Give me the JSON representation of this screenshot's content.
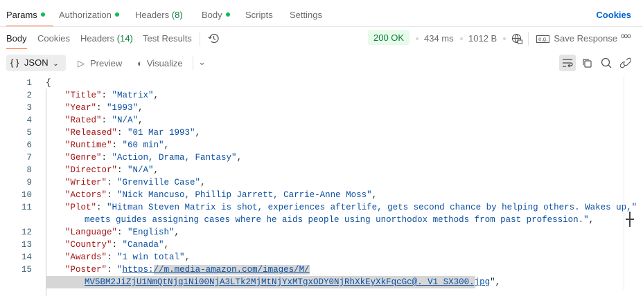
{
  "request_tabs": [
    {
      "label": "Params",
      "dot": true
    },
    {
      "label": "Authorization",
      "dot": true
    },
    {
      "label": "Headers",
      "count": "(8)"
    },
    {
      "label": "Body",
      "dot": true
    },
    {
      "label": "Scripts"
    },
    {
      "label": "Settings"
    }
  ],
  "cookies_link": "Cookies",
  "response_tabs": [
    {
      "label": "Body"
    },
    {
      "label": "Cookies"
    },
    {
      "label": "Headers",
      "count": "(14)"
    },
    {
      "label": "Test Results"
    }
  ],
  "status": "200 OK",
  "time": "434 ms",
  "size": "1012 B",
  "save_response": "Save Response",
  "toolbar": {
    "format": "JSON",
    "preview": "Preview",
    "visualize": "Visualize"
  },
  "lines": [
    {
      "n": "1",
      "open": "{"
    },
    {
      "n": "2",
      "key": "Title",
      "value": "Matrix"
    },
    {
      "n": "3",
      "key": "Year",
      "value": "1993"
    },
    {
      "n": "4",
      "key": "Rated",
      "value": "N/A"
    },
    {
      "n": "5",
      "key": "Released",
      "value": "01 Mar 1993"
    },
    {
      "n": "6",
      "key": "Runtime",
      "value": "60 min"
    },
    {
      "n": "7",
      "key": "Genre",
      "value": "Action, Drama, Fantasy"
    },
    {
      "n": "8",
      "key": "Director",
      "value": "N/A"
    },
    {
      "n": "9",
      "key": "Writer",
      "value": "Grenville Case"
    },
    {
      "n": "10",
      "key": "Actors",
      "value": "Nick Mancuso, Phillip Jarrett, Carrie-Anne Moss"
    },
    {
      "n": "11",
      "key": "Plot",
      "value": "Hitman Steven Matrix is shot, experiences afterlife, gets second chance by helping others. Wakes up,",
      "cont": "meets guides assigning cases where he aids people using unorthodox methods from past profession."
    },
    {
      "n": "12",
      "key": "Language",
      "value": "English"
    },
    {
      "n": "13",
      "key": "Country",
      "value": "Canada"
    },
    {
      "n": "14",
      "key": "Awards",
      "value": "1 win total"
    },
    {
      "n": "15",
      "key": "Poster",
      "value": "https://m.media-amazon.com/images/M/",
      "cont": "MV5BM2JiZjU1NmQtNjg1Ni00NjA3LTk2MjMtNjYxMTgxODY0NjRhXkEyXkFqcGc@._V1_SX300.jpg",
      "link": true
    }
  ],
  "colors": {
    "accent": "#ff6c37",
    "ok": "#0d7d3c",
    "link": "#0265d2"
  }
}
